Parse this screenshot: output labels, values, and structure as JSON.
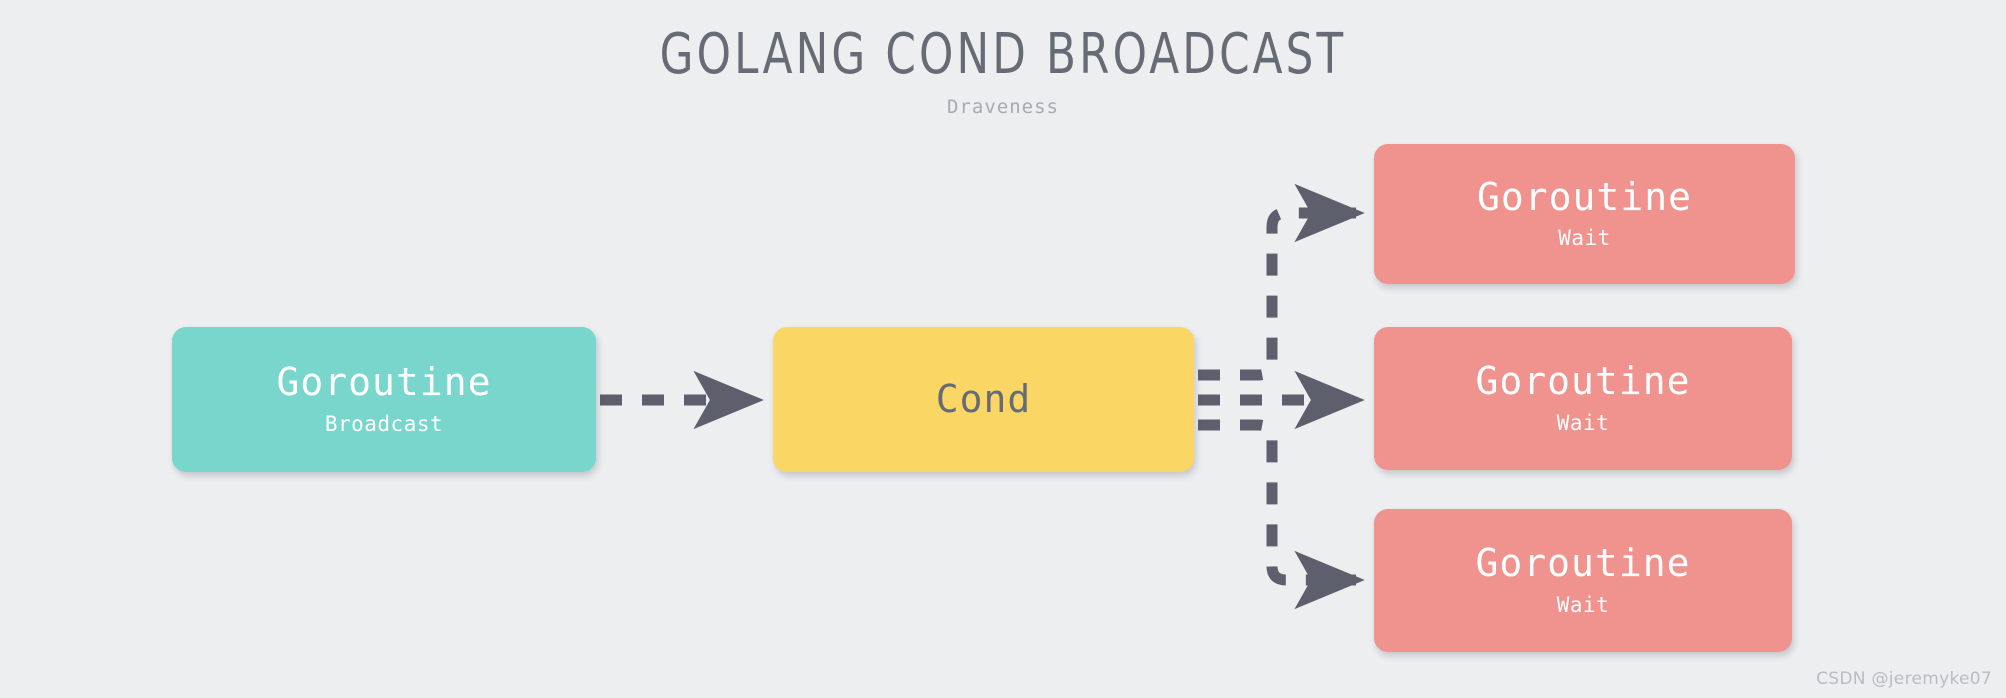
{
  "header": {
    "title": "GOLANG COND BROADCAST",
    "subtitle": "Draveness"
  },
  "colors": {
    "background": "#eceef0",
    "title_text": "#676b75",
    "subtitle_text": "#a6abaf",
    "teal": "#79d6cc",
    "amber": "#fad665",
    "pink": "#f0928d",
    "edge": "#5d606c",
    "box_text_light": "#ffffff",
    "box_text_dark": "#676b75",
    "watermark_text": "#b9bcc0"
  },
  "nodes": {
    "broadcast": {
      "main": "Goroutine",
      "sub": "Broadcast"
    },
    "cond": {
      "main": "Cond",
      "sub": ""
    },
    "wait_1": {
      "main": "Goroutine",
      "sub": "Wait"
    },
    "wait_2": {
      "main": "Goroutine",
      "sub": "Wait"
    },
    "wait_3": {
      "main": "Goroutine",
      "sub": "Wait"
    }
  },
  "edges": [
    {
      "name": "broadcast-to-cond",
      "from": "broadcast",
      "to": "cond",
      "style": "dashed",
      "arrow": true
    },
    {
      "name": "cond-to-wait-1",
      "from": "cond",
      "to": "wait_1",
      "style": "dashed",
      "arrow": true
    },
    {
      "name": "cond-to-wait-2",
      "from": "cond",
      "to": "wait_2",
      "style": "dashed",
      "arrow": true
    },
    {
      "name": "cond-to-wait-3",
      "from": "cond",
      "to": "wait_3",
      "style": "dashed",
      "arrow": true
    }
  ],
  "watermark": {
    "text": "CSDN @jeremyke07"
  }
}
